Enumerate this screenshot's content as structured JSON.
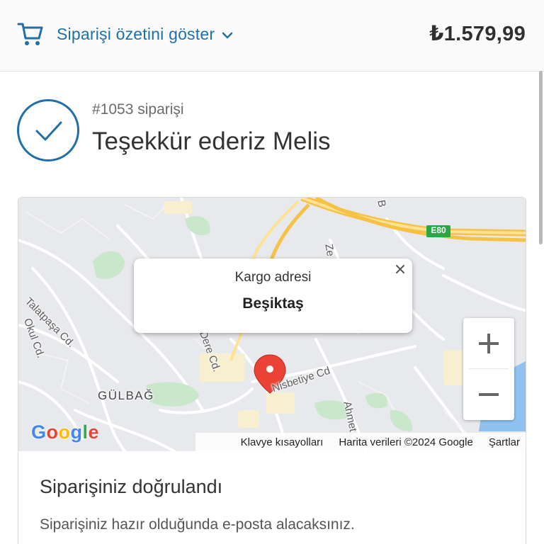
{
  "header": {
    "summary_toggle_label": "Siparişi özetini göster",
    "total_price": "₺1.579,99"
  },
  "order": {
    "number_label": "#1053 siparişi",
    "thanks_title": "Teşekkür ederiz Melis"
  },
  "map": {
    "popup_title": "Kargo adresi",
    "popup_value": "Beşiktaş",
    "zoom_in_label": "+",
    "zoom_out_label": "−",
    "attribution": {
      "shortcuts": "Klavye kısayolları",
      "map_data": "Harita verileri ©2024 Google",
      "terms": "Şartlar"
    },
    "streets": {
      "talatpasa": "Talatpaşa Cd.",
      "okul": "Okul Cd.",
      "dere": "Dere Cd.",
      "nisbetiye": "Nisbetiye Cd",
      "gulbag": "GÜLBAĞ",
      "e80": "E80",
      "ze": "Ze",
      "ahmet": "Ahmet",
      "b": "B"
    },
    "google_logo": [
      "G",
      "o",
      "o",
      "g",
      "l",
      "e"
    ]
  },
  "confirmation": {
    "title": "Siparişiniz doğrulandı",
    "text": "Siparişiniz hazır olduğunda e-posta alacaksınız."
  },
  "colors": {
    "accent": "#1f6fa8",
    "marker": "#ea4335",
    "highway": "#f6c64c"
  },
  "icons": {
    "cart": "cart-icon",
    "chevron": "chevron-down-icon",
    "check": "check-icon",
    "close": "close-icon",
    "marker": "map-marker-icon"
  }
}
